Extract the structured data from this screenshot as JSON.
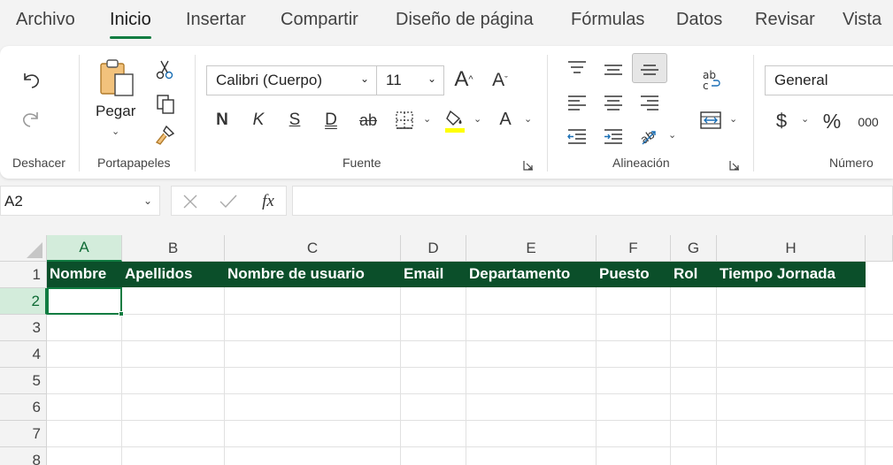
{
  "menu": {
    "tabs": [
      {
        "label": "Archivo"
      },
      {
        "label": "Inicio",
        "active": true
      },
      {
        "label": "Insertar"
      },
      {
        "label": "Compartir"
      },
      {
        "label": "Diseño de página"
      },
      {
        "label": "Fórmulas"
      },
      {
        "label": "Datos"
      },
      {
        "label": "Revisar"
      },
      {
        "label": "Vista"
      }
    ]
  },
  "ribbon": {
    "undo_group_label": "Deshacer",
    "clipboard": {
      "paste_label": "Pegar",
      "group_label": "Portapapeles"
    },
    "font": {
      "font_name": "Calibri (Cuerpo)",
      "font_size": "11",
      "bold_label": "N",
      "italic_label": "K",
      "underline_label": "S",
      "double_underline_label": "D",
      "strikethrough_label": "ab",
      "grow_label": "A",
      "shrink_label": "A",
      "font_color_label": "A",
      "group_label": "Fuente"
    },
    "alignment": {
      "group_label": "Alineación"
    },
    "number": {
      "format": "General",
      "currency_label": "$",
      "percent_label": "%",
      "thousands_label": "000",
      "group_label": "Número"
    }
  },
  "formula_bar": {
    "name_box": "A2",
    "fx_label": "fx",
    "formula": ""
  },
  "sheet": {
    "columns": [
      "A",
      "B",
      "C",
      "D",
      "E",
      "F",
      "G",
      "H"
    ],
    "rows": [
      "1",
      "2",
      "3",
      "4",
      "5",
      "6",
      "7",
      "8"
    ],
    "selected_column": "A",
    "selected_row": "2",
    "header_row": [
      "Nombre",
      "Apellidos",
      "Nombre de usuario",
      "Email",
      "Departamento",
      "Puesto",
      "Rol",
      "Tiempo Jornada"
    ]
  },
  "colors": {
    "accent": "#107c41",
    "header_fill": "#0b4f2a",
    "highlight_yellow": "#ffff00"
  }
}
